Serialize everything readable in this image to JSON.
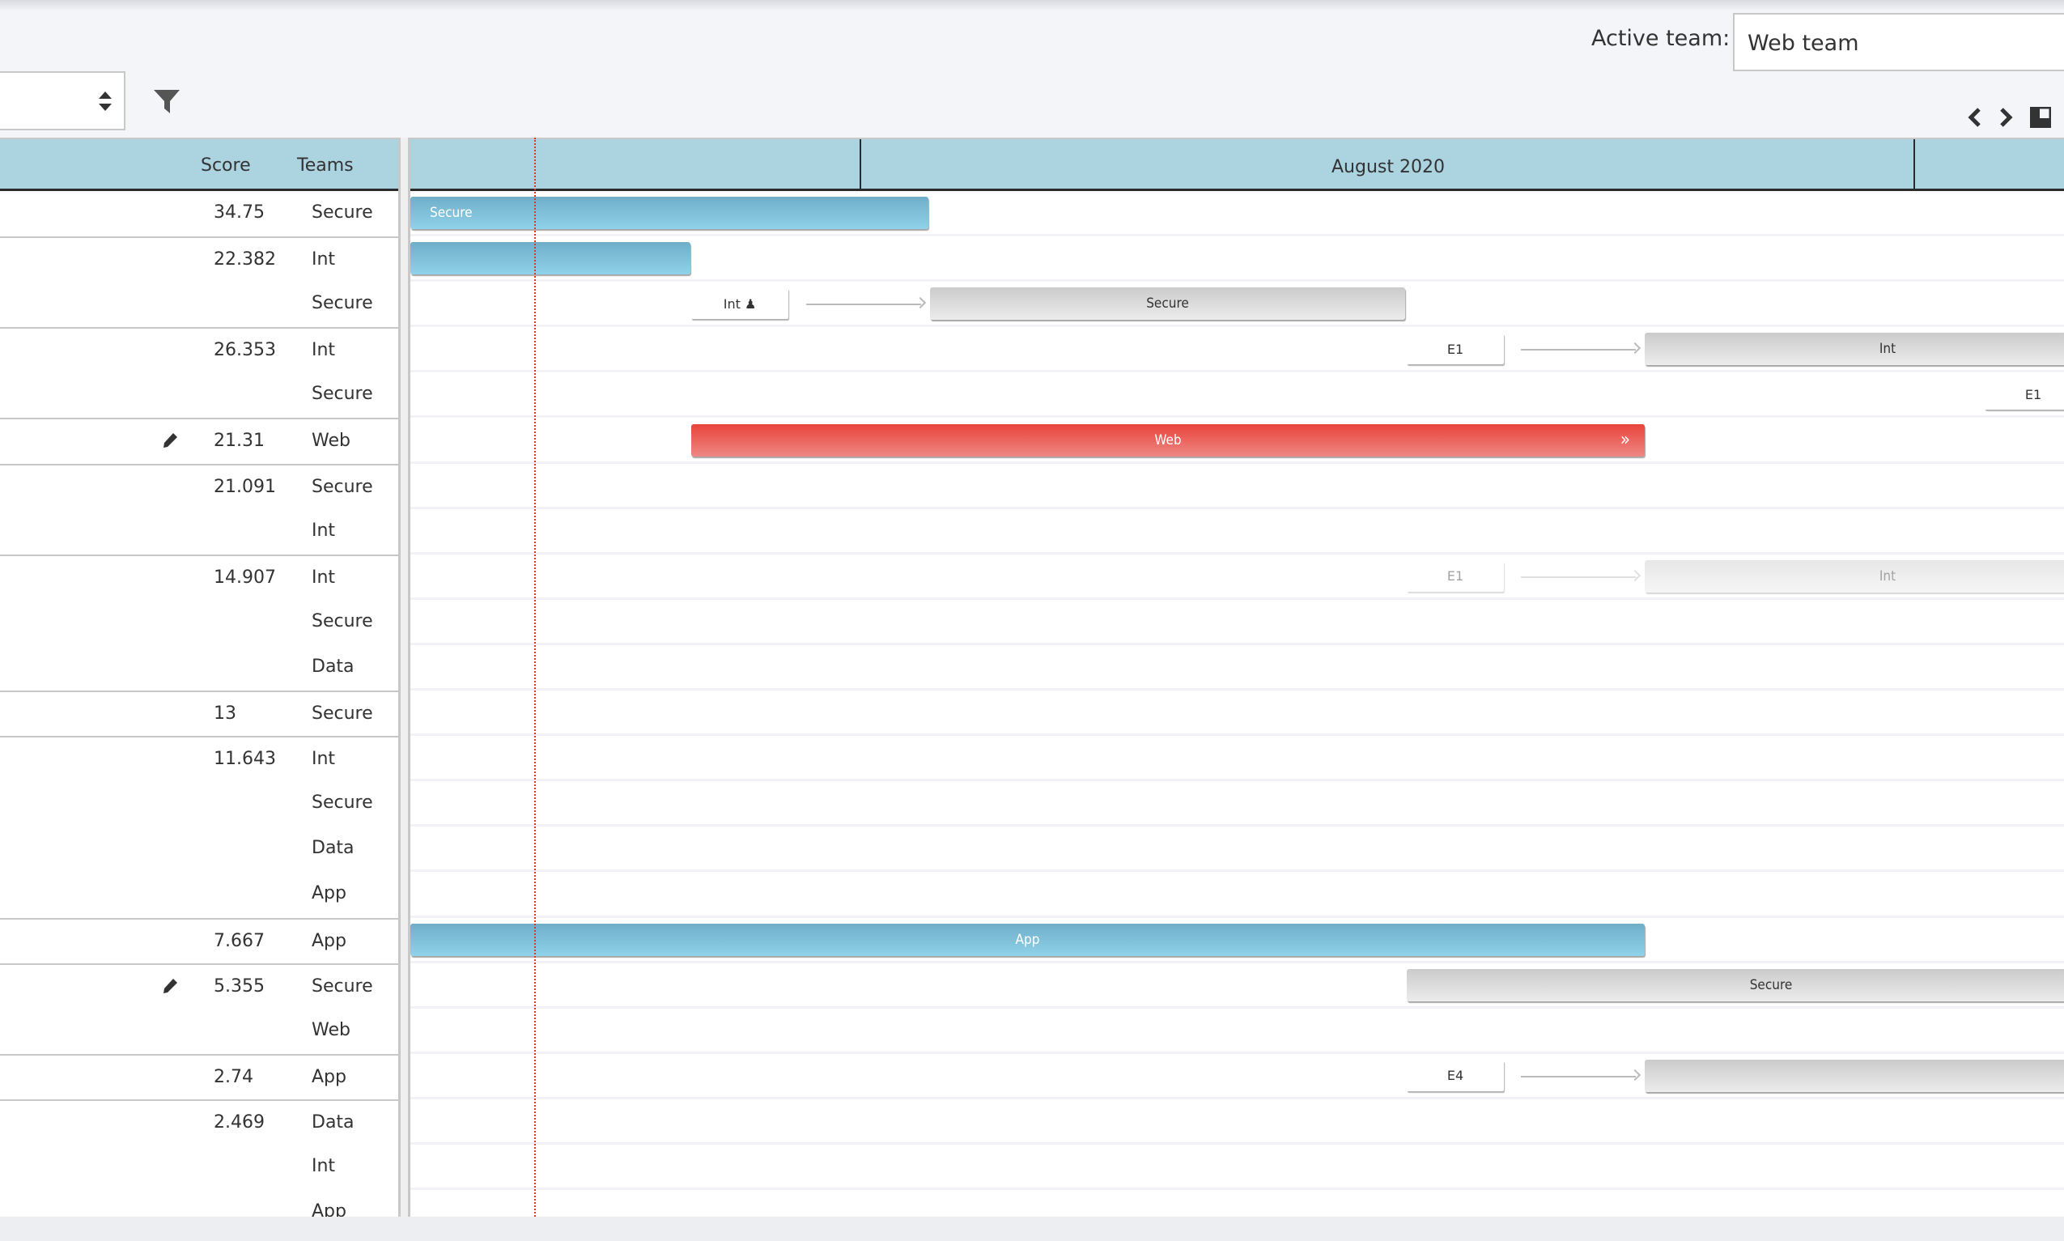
{
  "toolbar": {
    "active_team_label": "Active team:",
    "active_team_value": "Web team",
    "sort_select_value": "",
    "filter_icon": "filter-icon",
    "prev_icon": "chevron-left-icon",
    "next_icon": "chevron-right-icon",
    "layout_icon": "layout-toggle-icon"
  },
  "grid": {
    "columns": {
      "score": "Score",
      "teams": "Teams"
    },
    "rows": [
      {
        "score": "34.75",
        "teams": [
          "Secure"
        ],
        "editable": false
      },
      {
        "score": "22.382",
        "teams": [
          "Int",
          "Secure"
        ],
        "editable": false
      },
      {
        "score": "26.353",
        "teams": [
          "Int",
          "Secure"
        ],
        "editable": false
      },
      {
        "score": "21.31",
        "teams": [
          "Web"
        ],
        "editable": true
      },
      {
        "score": "21.091",
        "teams": [
          "Secure",
          "Int"
        ],
        "editable": false
      },
      {
        "score": "14.907",
        "teams": [
          "Int",
          "Secure",
          "Data"
        ],
        "editable": false
      },
      {
        "score": "13",
        "teams": [
          "Secure"
        ],
        "editable": false
      },
      {
        "score": "11.643",
        "teams": [
          "Int",
          "Secure",
          "Data",
          "App"
        ],
        "editable": false
      },
      {
        "score": "7.667",
        "teams": [
          "App"
        ],
        "editable": false
      },
      {
        "score": "5.355",
        "teams": [
          "Secure",
          "Web"
        ],
        "editable": true
      },
      {
        "score": "2.74",
        "teams": [
          "App"
        ],
        "editable": false
      },
      {
        "score": "2.469",
        "teams": [
          "Data",
          "Int",
          "App"
        ],
        "editable": false
      }
    ]
  },
  "gantt": {
    "month_label": "August 2020",
    "colors": {
      "blue": "#7fc2dc",
      "red": "#e8443a",
      "grey": "#dcdcdc",
      "today": "#e0342f"
    },
    "bars": [
      {
        "row": 0,
        "type": "blue",
        "label": "Secure"
      },
      {
        "row": 1,
        "type": "blue",
        "label": ""
      },
      {
        "row": 2,
        "type": "ebox",
        "label": "Int ♟"
      },
      {
        "row": 2,
        "type": "grey",
        "label": "Secure"
      },
      {
        "row": 3,
        "type": "ebox",
        "label": "E1"
      },
      {
        "row": 3,
        "type": "grey",
        "label": "Int"
      },
      {
        "row": 4,
        "type": "ebox",
        "label": "E1"
      },
      {
        "row": 5,
        "type": "red",
        "label": "Web",
        "icon": "»"
      },
      {
        "row": 8,
        "type": "ebox",
        "label": "E1",
        "faded": true
      },
      {
        "row": 8,
        "type": "grey",
        "label": "Int",
        "faded": true
      },
      {
        "row": 16,
        "type": "blue",
        "label": "App"
      },
      {
        "row": 17,
        "type": "grey",
        "label": "Secure"
      },
      {
        "row": 19,
        "type": "ebox",
        "label": "E4"
      },
      {
        "row": 19,
        "type": "grey",
        "label": ""
      }
    ]
  }
}
